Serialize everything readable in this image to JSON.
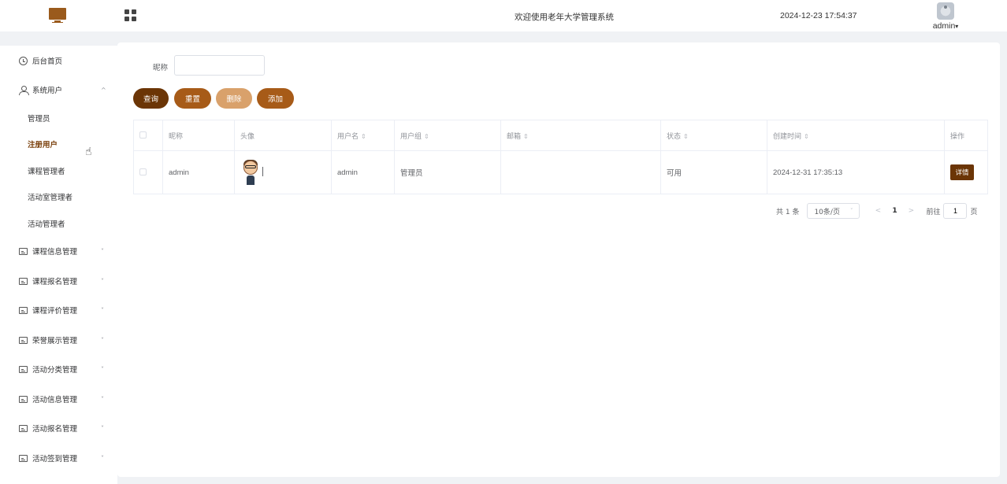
{
  "header": {
    "welcome": "欢迎使用老年大学管理系统",
    "datetime": "2024-12-23 17:54:37",
    "username": "admin",
    "caret": "▾"
  },
  "sidebar": {
    "items": [
      {
        "label": "后台首页",
        "icon": "clock-icon"
      },
      {
        "label": "系统用户",
        "icon": "user-icon",
        "arrow": "^"
      },
      {
        "label": "课程信息管理",
        "icon": "card-icon",
        "arrow": "˅"
      },
      {
        "label": "课程报名管理",
        "icon": "card-icon",
        "arrow": "˅"
      },
      {
        "label": "课程评价管理",
        "icon": "card-icon",
        "arrow": "˅"
      },
      {
        "label": "荣誉展示管理",
        "icon": "card-icon",
        "arrow": "˅"
      },
      {
        "label": "活动分类管理",
        "icon": "card-icon",
        "arrow": "˅"
      },
      {
        "label": "活动信息管理",
        "icon": "card-icon",
        "arrow": "˅"
      },
      {
        "label": "活动报名管理",
        "icon": "card-icon",
        "arrow": "˅"
      },
      {
        "label": "活动签到管理",
        "icon": "card-icon",
        "arrow": "˅"
      }
    ],
    "subitems": [
      {
        "label": "管理员"
      },
      {
        "label": "注册用户",
        "active": true
      },
      {
        "label": "课程管理者"
      },
      {
        "label": "活动室管理者"
      },
      {
        "label": "活动管理者"
      }
    ]
  },
  "search": {
    "label": "昵称",
    "value": "",
    "placeholder": ""
  },
  "buttons": {
    "search": "查询",
    "reset": "重置",
    "delete": "删除",
    "add": "添加"
  },
  "table": {
    "columns": [
      "昵称",
      "头像",
      "用户名",
      "用户组",
      "邮箱",
      "状态",
      "创建时间",
      "操作"
    ],
    "sort_icon": "⇕",
    "rows": [
      {
        "nickname": "admin",
        "username": "admin",
        "group": "管理员",
        "email": "",
        "status": "可用",
        "created": "2024-12-31 17:35:13",
        "action": "详情"
      }
    ]
  },
  "pagination": {
    "total": "共 1 条",
    "page_size": "10条/页",
    "prev": "<",
    "current": "1",
    "next": ">",
    "goto": "前往",
    "jump_value": "1",
    "page_suffix": "页"
  }
}
